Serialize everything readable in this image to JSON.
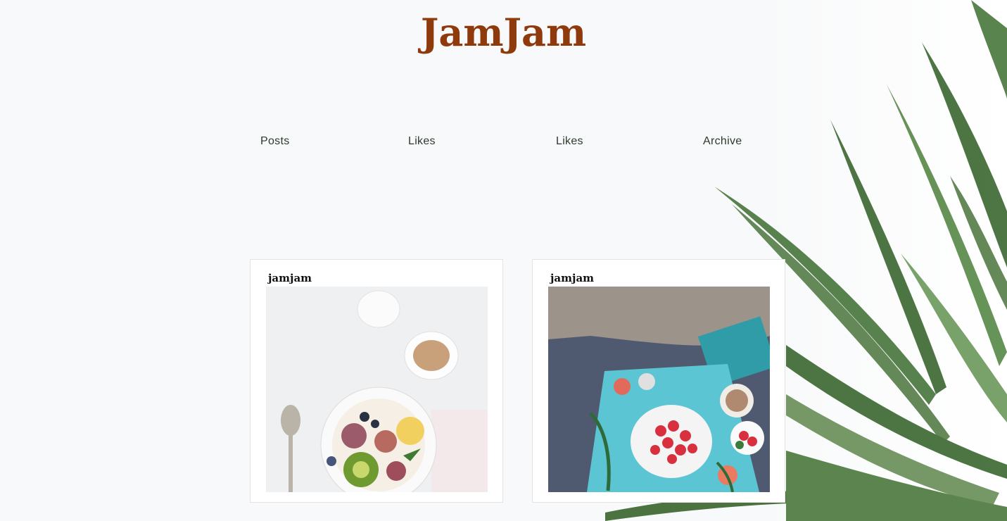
{
  "header": {
    "title": "JamJam"
  },
  "nav": {
    "items": [
      "Posts",
      "Likes",
      "Likes",
      "Archive"
    ]
  },
  "posts": [
    {
      "author": "jamjam",
      "image": "breakfast-bowl-photo"
    },
    {
      "author": "jamjam",
      "image": "breakfast-tray-photo"
    }
  ],
  "colors": {
    "title": "#8f3a0c",
    "nav": "#2e3a2e",
    "background": "#f8f9fa",
    "leaf": "#3f6a35"
  }
}
